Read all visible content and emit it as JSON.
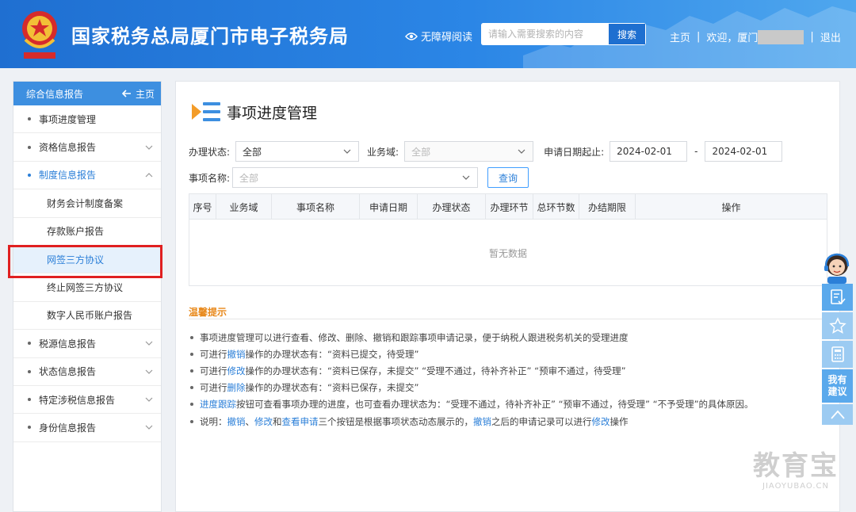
{
  "header": {
    "site_title": "国家税务总局厦门市电子税务局",
    "accessibility_label": "无障碍阅读",
    "search_placeholder": "请输入需要搜索的内容",
    "search_button": "搜索",
    "home_link": "主页",
    "welcome_text": "欢迎，厦门",
    "logout_link": "退出"
  },
  "sidebar": {
    "header_title": "综合信息报告",
    "home_label": "主页",
    "items": [
      {
        "label": "事项进度管理"
      },
      {
        "label": "资格信息报告"
      },
      {
        "label": "制度信息报告"
      },
      {
        "label": "财务会计制度备案"
      },
      {
        "label": "存款账户报告"
      },
      {
        "label": "网签三方协议"
      },
      {
        "label": "终止网签三方协议"
      },
      {
        "label": "数字人民币账户报告"
      },
      {
        "label": "税源信息报告"
      },
      {
        "label": "状态信息报告"
      },
      {
        "label": "特定涉税信息报告"
      },
      {
        "label": "身份信息报告"
      }
    ]
  },
  "main": {
    "title": "事项进度管理",
    "filters": {
      "status_label": "办理状态:",
      "status_value": "全部",
      "domain_label": "业务域:",
      "domain_value": "全部",
      "date_label": "申请日期起止:",
      "date_from": "2024-02-01",
      "date_separator": "-",
      "date_to": "2024-02-01",
      "item_label": "事项名称:",
      "item_value": "全部",
      "query_button": "查询"
    },
    "table": {
      "headers": [
        "序号",
        "业务域",
        "事项名称",
        "申请日期",
        "办理状态",
        "办理环节",
        "总环节数",
        "办结期限",
        "操作"
      ],
      "empty_text": "暂无数据"
    },
    "tips": {
      "title": "温馨提示",
      "l1": "事项进度管理可以进行查看、修改、删除、撤销和跟踪事项申请记录，便于纳税人跟进税务机关的受理进度",
      "l2a": "可进行",
      "l2b": "撤销",
      "l2c": "操作的办理状态有：“资料已提交，待受理”",
      "l3a": "可进行",
      "l3b": "修改",
      "l3c": "操作的办理状态有：“资料已保存，未提交” “受理不通过，待补齐补正” “预审不通过，待受理”",
      "l4a": "可进行",
      "l4b": "删除",
      "l4c": "操作的办理状态有：“资料已保存，未提交”",
      "l5a": "进度跟踪",
      "l5b": "按钮可查看事项办理的进度，也可查看办理状态为：“受理不通过，待补齐补正” “预审不通过，待受理” “不予受理”的具体原因。",
      "l6a": "说明：",
      "l6b": "撤销",
      "l6c": "、",
      "l6d": "修改",
      "l6e": "和",
      "l6f": "查看申请",
      "l6g": "三个按钮是根据事项状态动态展示的，",
      "l6h": "撤销",
      "l6i": "之后的申请记录可以进行",
      "l6j": "修改",
      "l6k": "操作"
    }
  },
  "float_tools": {
    "suggest_text": "我有建议"
  },
  "watermark": {
    "main": "教育宝",
    "sub": "JIAOYUBAO.CN"
  },
  "colors": {
    "header_blue": "#2b86e6",
    "accent_blue": "#2b7fd8",
    "tip_orange": "#e8891c",
    "highlight_red": "#e02020"
  }
}
